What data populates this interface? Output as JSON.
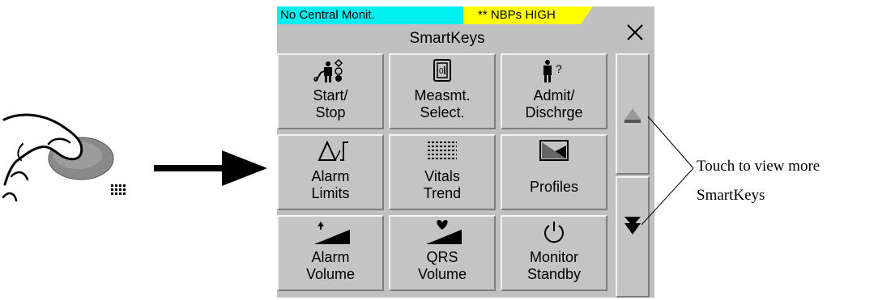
{
  "status": {
    "left": "No Central Monit.",
    "right": "** NBPs HIGH",
    "left_color": "#00f0f0",
    "right_color": "#ffff00"
  },
  "window": {
    "title": "SmartKeys",
    "close_icon": "close-icon"
  },
  "keys": [
    {
      "line1": "Start/",
      "line2": "Stop",
      "icon": "start-stop-nbp-icon"
    },
    {
      "line1": "Measmt.",
      "line2": "Select.",
      "icon": "measurement-select-icon"
    },
    {
      "line1": "Admit/",
      "line2": "Dischrge",
      "icon": "admit-discharge-icon"
    },
    {
      "line1": "Alarm",
      "line2": "Limits",
      "icon": "alarm-limits-icon"
    },
    {
      "line1": "Vitals",
      "line2": "Trend",
      "icon": "vitals-trend-icon"
    },
    {
      "line1": "Profiles",
      "line2": "",
      "icon": "profiles-icon"
    },
    {
      "line1": "Alarm",
      "line2": "Volume",
      "icon": "alarm-volume-icon"
    },
    {
      "line1": "QRS",
      "line2": "Volume",
      "icon": "qrs-volume-icon"
    },
    {
      "line1": "Monitor",
      "line2": "Standby",
      "icon": "power-icon"
    }
  ],
  "scroll": {
    "up_icon": "scroll-up-icon",
    "down_icon": "scroll-down-icon"
  },
  "callout": {
    "line1": "Touch to view more",
    "line2": "SmartKeys"
  },
  "illustration": {
    "hand_icon": "finger-press-icon",
    "arrow_icon": "right-arrow-icon"
  }
}
